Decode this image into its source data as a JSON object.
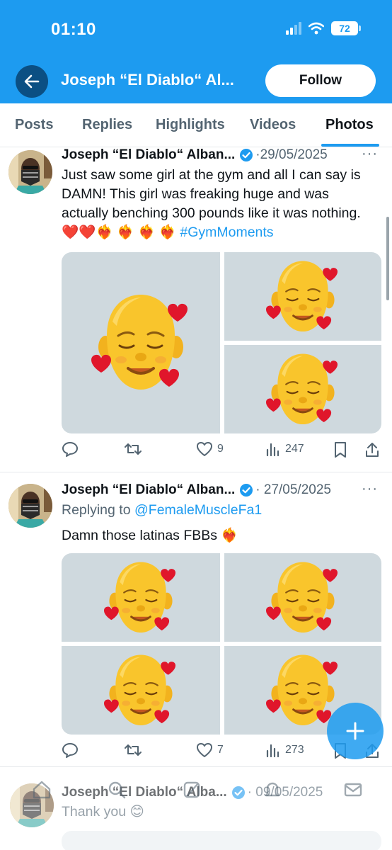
{
  "status_bar": {
    "time": "01:10",
    "battery": "72"
  },
  "header": {
    "profile_name": "Joseph “El Diablo“ Al...",
    "follow_label": "Follow"
  },
  "tabs": [
    {
      "label": "Posts"
    },
    {
      "label": "Replies"
    },
    {
      "label": "Highlights"
    },
    {
      "label": "Videos"
    },
    {
      "label": "Photos",
      "active": true
    }
  ],
  "tweets": [
    {
      "name": "Joseph “El Diablo“ Alban...",
      "date": "·29/05/2025",
      "text": "Just saw some girl at the gym and all I can say is DAMN! This girl was freaking huge and was actually benching 300 pounds like it was nothing. ❤️❤️❤️‍🔥 ❤️‍🔥 ❤️‍🔥 ❤️‍🔥 ",
      "hashtag": "#GymMoments",
      "likes": "9",
      "views": "247"
    },
    {
      "name": "Joseph “El Diablo“ Alban...",
      "date": "· 27/05/2025",
      "replying_prefix": "Replying to ",
      "replying_handle": "@FemaleMuscleFa1",
      "text": "Damn those latinas FBBs ❤️‍🔥",
      "likes": "7",
      "views": "273"
    },
    {
      "name": "Joseph “El Diablo“ Alba...",
      "date": "· 09/05/2025",
      "text": "Thank you 😊"
    }
  ],
  "colors": {
    "accent": "#1d9bf0",
    "text": "#0f1419",
    "muted": "#536471",
    "image_bg": "#cfd9de"
  },
  "icons": [
    "back-arrow-icon",
    "verified-icon",
    "more-icon",
    "reply-icon",
    "retweet-icon",
    "like-icon",
    "views-icon",
    "bookmark-icon",
    "share-icon",
    "compose-plus-icon",
    "home-icon",
    "search-icon",
    "grok-icon",
    "notifications-icon",
    "messages-icon"
  ]
}
